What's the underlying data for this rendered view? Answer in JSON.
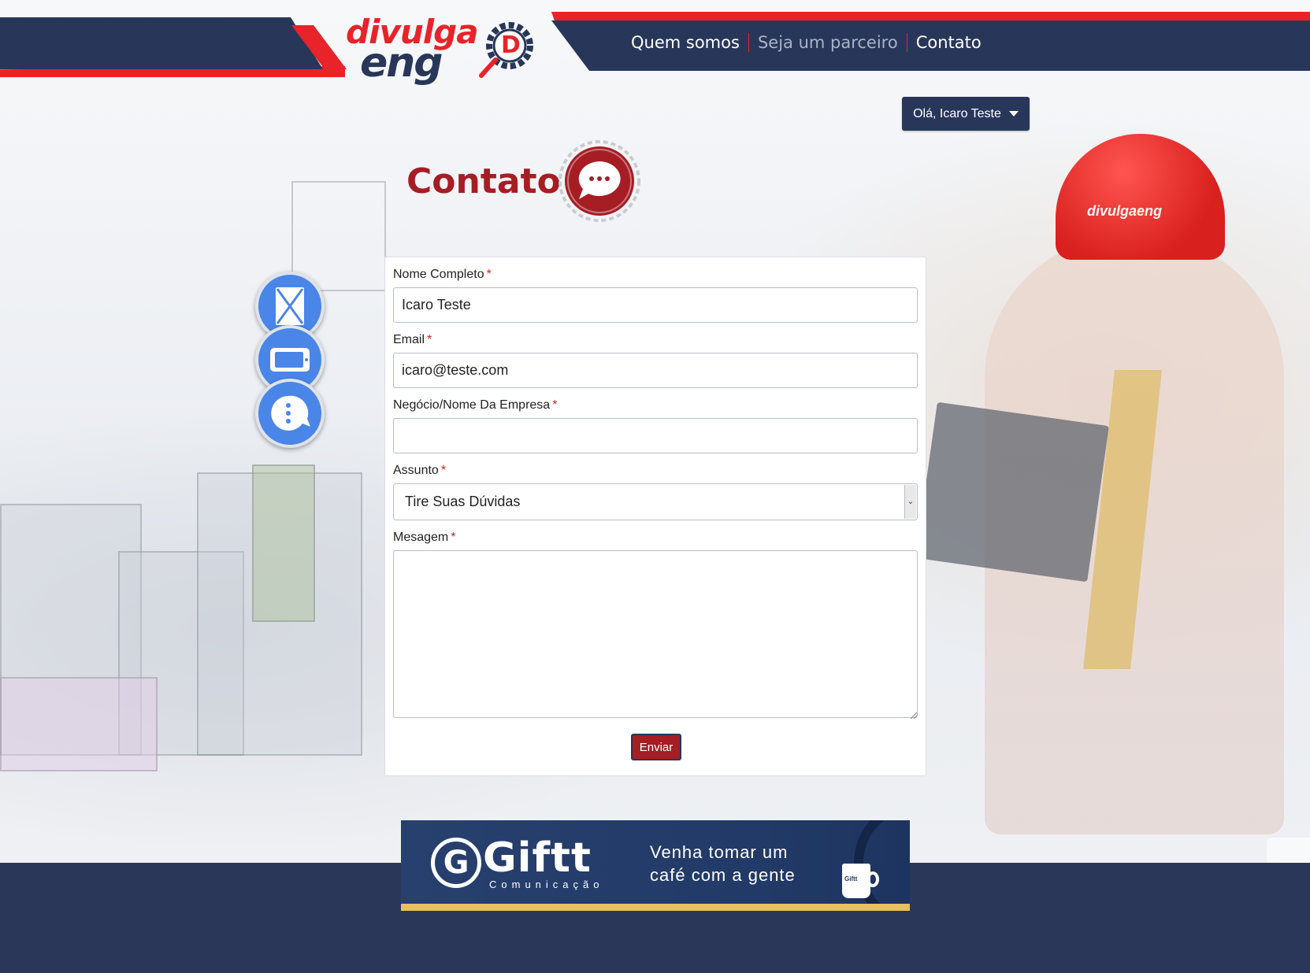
{
  "header": {
    "logo_line1": "divulga",
    "logo_line2": "eng",
    "logo_badge": "D",
    "nav": [
      {
        "label": "Quem somos"
      },
      {
        "label": "Seja um parceiro"
      },
      {
        "label": "Contato"
      }
    ]
  },
  "user_menu": {
    "label": "Olá, Icaro Teste"
  },
  "page": {
    "title": "Contato"
  },
  "side_icons": [
    "envelope-icon",
    "phone-icon",
    "chat-icon"
  ],
  "form": {
    "fields": {
      "name": {
        "label": "Nome Completo",
        "value": "Icaro Teste"
      },
      "email": {
        "label": "Email",
        "value": "icaro@teste.com"
      },
      "company": {
        "label": "Negócio/Nome Da Empresa",
        "value": ""
      },
      "subject": {
        "label": "Assunto",
        "value": "Tire Suas Dúvidas"
      },
      "message": {
        "label": "Mesagem",
        "value": ""
      }
    },
    "required_mark": "*",
    "submit_label": "Enviar"
  },
  "banner": {
    "brand": "Giftt",
    "brand_initial": "G",
    "subtitle": "Comunicação",
    "tagline_1": "Venha tomar um",
    "tagline_2": "café com a gente",
    "cup_label": "Giftt"
  },
  "helmet_logo": "divulgaeng",
  "colors": {
    "navy": "#283759",
    "red": "#e8232a",
    "title_red": "#a61d24",
    "accent_blue": "#4a86e8"
  }
}
